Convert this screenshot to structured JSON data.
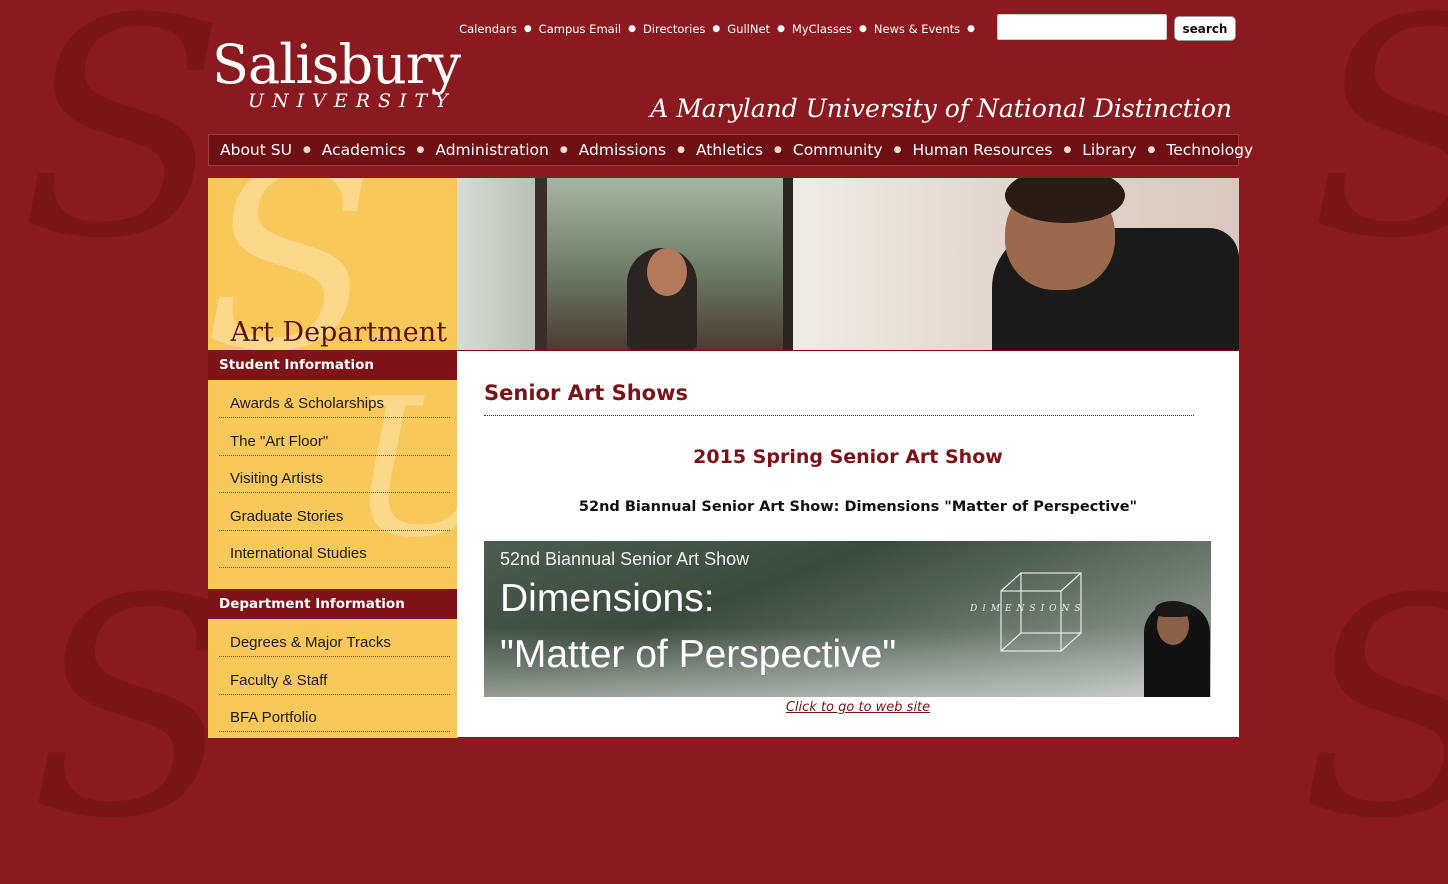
{
  "utility_nav": {
    "links": [
      "Calendars",
      "Campus Email",
      "Directories",
      "GullNet",
      "MyClasses",
      "News & Events"
    ],
    "search_placeholder": "",
    "search_button": "search"
  },
  "header": {
    "logo_main": "Salisbury",
    "logo_sub": "UNIVERSITY",
    "tagline": "A Maryland University of National Distinction"
  },
  "main_nav": [
    "About SU",
    "Academics",
    "Administration",
    "Admissions",
    "Athletics",
    "Community",
    "Human Resources",
    "Library",
    "Technology"
  ],
  "sidebar": {
    "department_title": "Art Department",
    "sections": [
      {
        "heading": "Student Information",
        "links": [
          "Awards & Scholarships",
          "The \"Art Floor\"",
          "Visiting Artists",
          "Graduate Stories",
          "International Studies"
        ]
      },
      {
        "heading": "Department Information",
        "links": [
          "Degrees & Major Tracks",
          "Faculty & Staff",
          "BFA Portfolio"
        ]
      }
    ]
  },
  "content": {
    "page_title": "Senior Art Shows",
    "show_title": "2015 Spring Senior Art Show",
    "show_subtitle": "52nd Biannual Senior Art Show: Dimensions \"Matter of Perspective\"",
    "banner": {
      "line1": "52nd Biannual Senior Art Show",
      "line2": "Dimensions:",
      "line3": "\"Matter of Perspective\"",
      "cube_label": "DIMENSIONS"
    },
    "banner_link": "Click to go to web site"
  },
  "colors": {
    "background": "#8a1a1f",
    "nav_bar": "#6d0f13",
    "sidebar": "#f8c85b",
    "section_heading": "#7e1318",
    "title_text": "#7a1318"
  }
}
